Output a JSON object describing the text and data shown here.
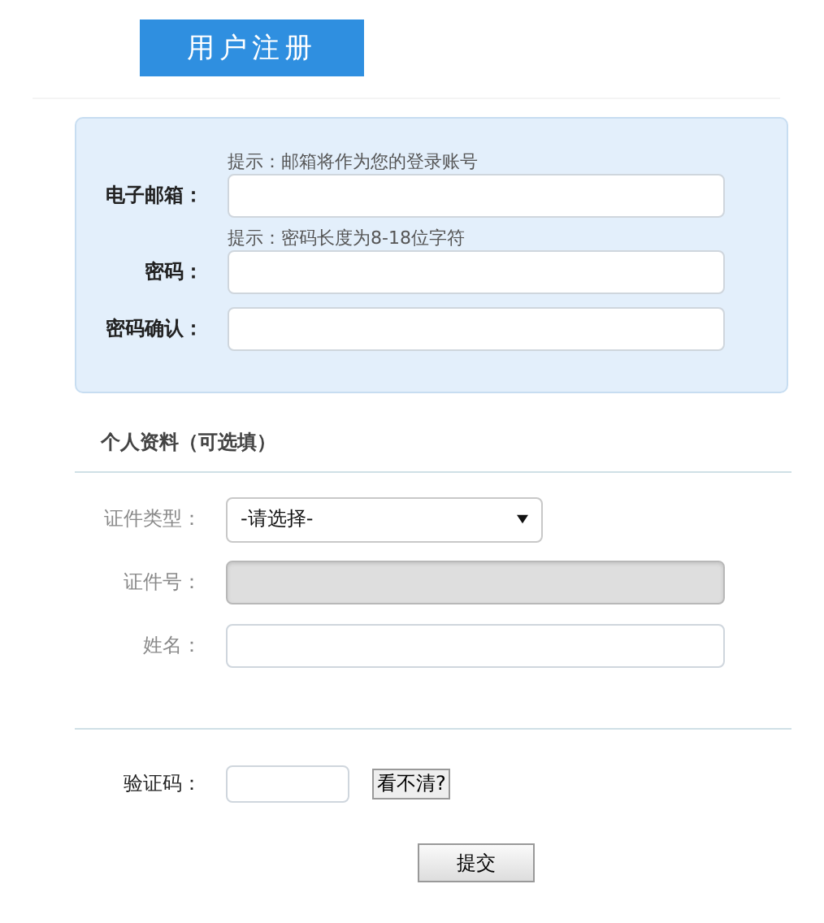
{
  "header": {
    "title": "用户注册"
  },
  "account": {
    "fields": [
      {
        "label": "电子邮箱：",
        "hint": "提示：邮箱将作为您的登录账号"
      },
      {
        "label": "密码：",
        "hint": "提示：密码长度为8-18位字符"
      },
      {
        "label": "密码确认："
      }
    ]
  },
  "personal": {
    "title": "个人资料（可选填）",
    "fields": [
      {
        "kind": "select",
        "label": "证件类型：",
        "value": "-请选择-",
        "disabled": false
      },
      {
        "kind": "text",
        "label": "证件号：",
        "disabled": true
      },
      {
        "kind": "text",
        "label": "姓名：",
        "disabled": false
      }
    ]
  },
  "captcha": {
    "label": "验证码：",
    "refresh": "看不清?"
  },
  "submit": "提交"
}
